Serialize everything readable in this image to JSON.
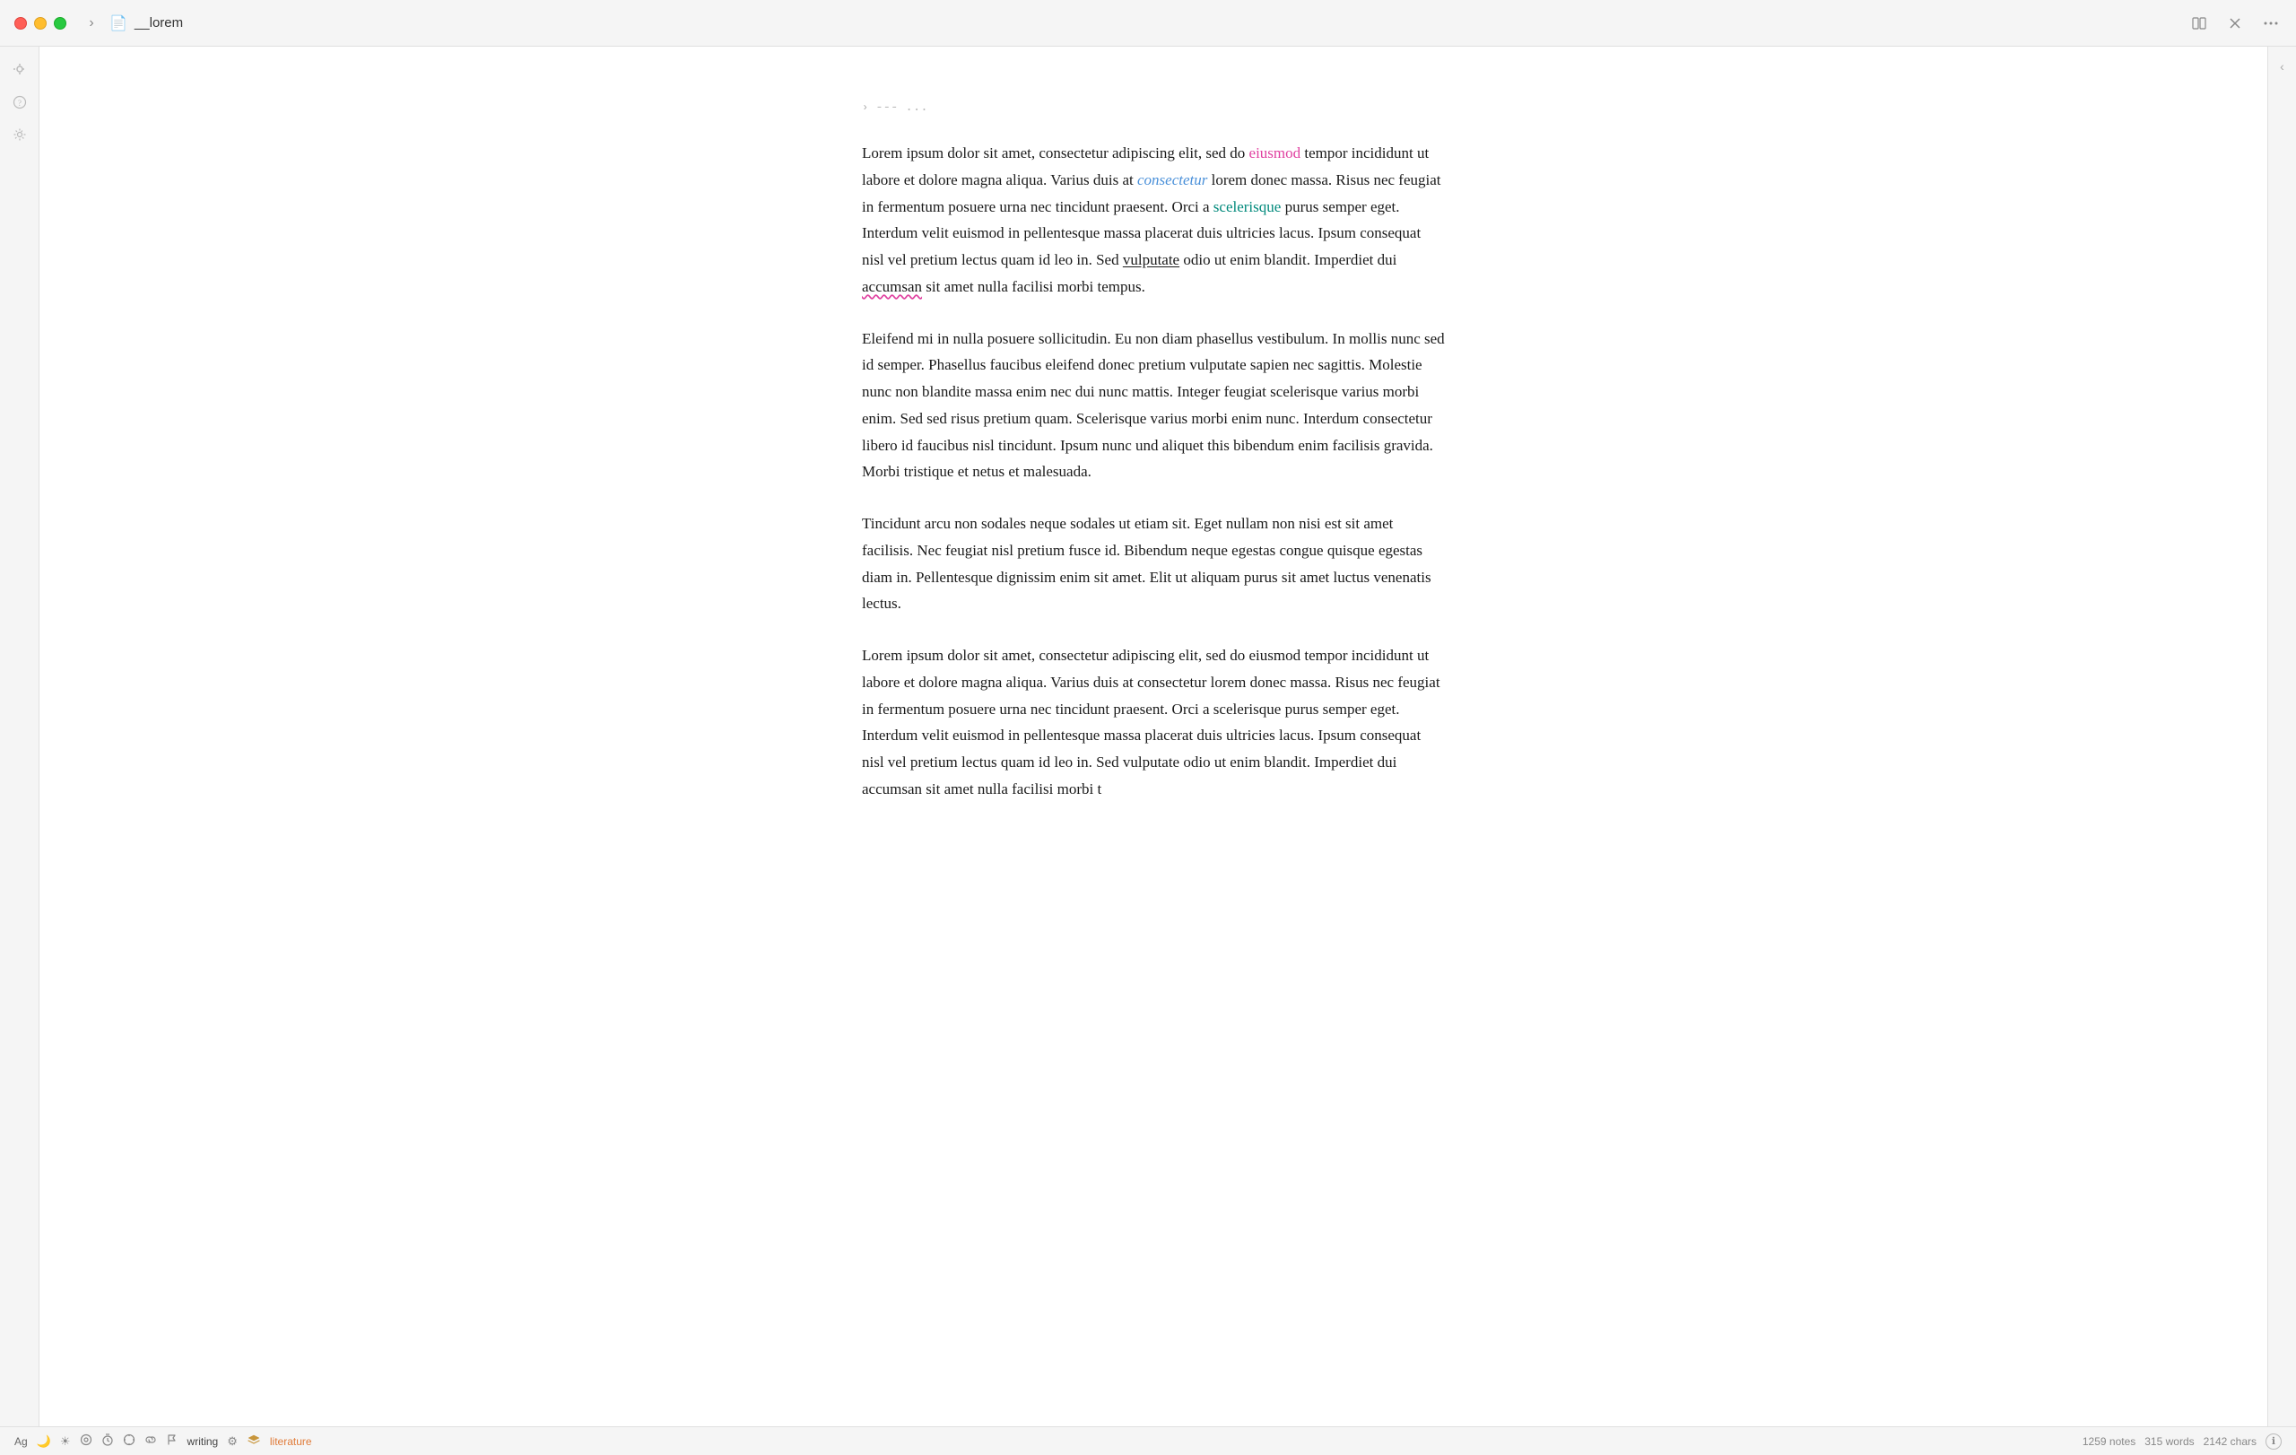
{
  "titlebar": {
    "title": "__lorem",
    "toggle_label": "›",
    "icon": "📄",
    "action_split": "⊞",
    "action_close": "✕",
    "action_more": "•••"
  },
  "frontmatter": {
    "toggle": "›",
    "dashes": "---",
    "dots": "..."
  },
  "paragraphs": [
    {
      "id": "p1",
      "text_parts": [
        {
          "type": "normal",
          "text": "Lorem ipsum dolor sit amet, consectetur adipiscing elit, sed do "
        },
        {
          "type": "pink",
          "text": "eiusmod"
        },
        {
          "type": "normal",
          "text": " tempor incididunt ut labore et dolore magna aliqua. Varius duis at "
        },
        {
          "type": "blue-link",
          "text": "consectetur"
        },
        {
          "type": "normal",
          "text": " lorem donec massa. Risus nec feugiat in fermentum posuere urna nec tincidunt praesent. Orci a "
        },
        {
          "type": "teal",
          "text": "scelerisque"
        },
        {
          "type": "normal",
          "text": " purus semper eget. Interdum velit euismod in pellentesque massa placerat duis ultricies lacus. Ipsum consequat nisl vel pretium lectus quam id leo in. Sed "
        },
        {
          "type": "underline-solid",
          "text": "vulputate"
        },
        {
          "type": "normal",
          "text": " odio ut enim blandit. Imperdiet dui "
        },
        {
          "type": "underline-wavy-pink",
          "text": "accumsan"
        },
        {
          "type": "normal",
          "text": " sit amet nulla facilisi morbi tempus."
        }
      ]
    },
    {
      "id": "p2",
      "text_parts": [
        {
          "type": "normal",
          "text": "Eleifend mi in nulla posuere sollicitudin. Eu non diam phasellus vestibulum. In mollis nunc sed id semper. Phasellus faucibus eleifend donec pretium vulputate sapien nec sagittis. Molestie nunc non blandite massa enim nec dui nunc mattis. Integer feugiat scelerisque varius morbi enim. Sed sed risus pretium quam. Scelerisque varius morbi enim nunc. Interdum consectetur libero id faucibus nisl tincidunt. Ipsum nunc und aliquet this bibendum enim facilisis gravida. Morbi tristique et netus et malesuada."
        }
      ]
    },
    {
      "id": "p3",
      "text_parts": [
        {
          "type": "normal",
          "text": "Tincidunt arcu non sodales neque sodales ut etiam sit. Eget nullam non nisi est sit amet facilisis. Nec feugiat nisl pretium fusce id. Bibendum neque egestas congue quisque egestas diam in. Pellentesque dignissim enim sit amet. Elit ut aliquam purus sit amet luctus venenatis lectus."
        }
      ]
    },
    {
      "id": "p4",
      "text_parts": [
        {
          "type": "normal",
          "text": "Lorem ipsum dolor sit amet, consectetur adipiscing elit, sed do eiusmod tempor incididunt ut labore et dolore magna aliqua. Varius duis at consectetur lorem donec massa. Risus nec feugiat in fermentum posuere urna nec tincidunt praesent. Orci a scelerisque purus semper eget. Interdum velit euismod in pellentesque massa placerat duis ultricies lacus. Ipsum consequat nisl vel pretium lectus quam id leo in. Sed vulputate odio ut enim blandit. Imperdiet dui accumsan sit amet nulla facilisi morbi t"
        }
      ]
    }
  ],
  "sidebar_icons": [
    {
      "name": "location-icon",
      "glyph": "⊙"
    },
    {
      "name": "help-icon",
      "glyph": "?"
    },
    {
      "name": "settings-icon",
      "glyph": "⚙"
    }
  ],
  "statusbar": {
    "ag_label": "Ag",
    "icon_moon": "🌙",
    "icon_sun": "☀",
    "icon_focus": "◎",
    "icon_clock": "⧖",
    "icon_target": "◎",
    "icon_pin": "⊥",
    "icon_flag": "⚑",
    "writing_label": "writing",
    "gear_icon": "⚙",
    "pile_icon": "🗂",
    "literature_label": "literature",
    "notes_count": "1259 notes",
    "words_count": "315 words",
    "chars_count": "2142 chars",
    "circle_icon": "ℹ"
  }
}
